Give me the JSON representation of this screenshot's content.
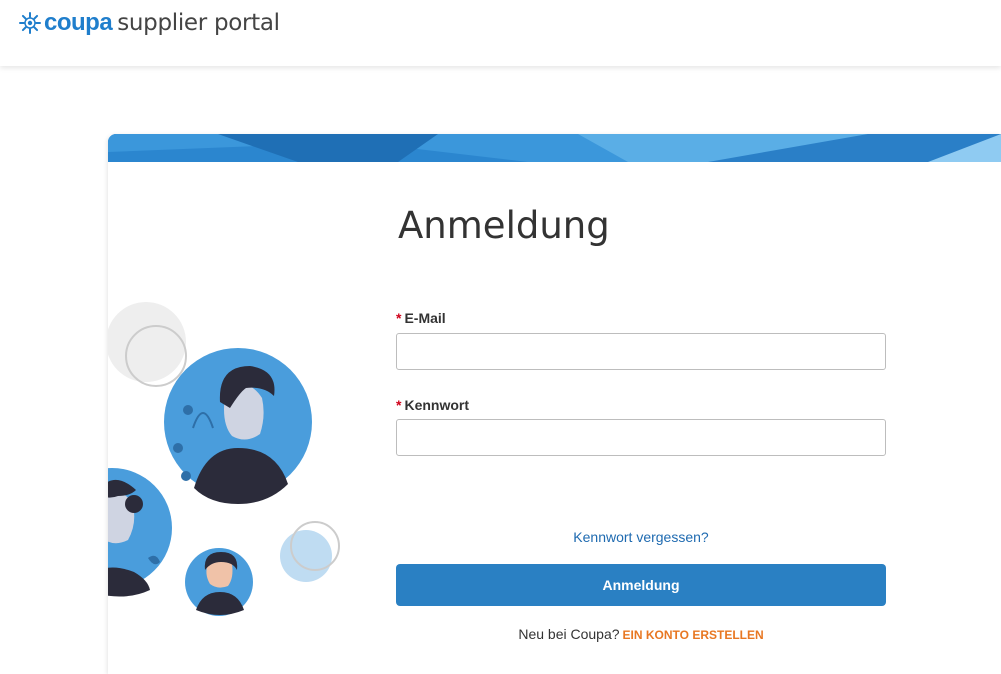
{
  "header": {
    "logo_brand": "coupa",
    "logo_rest": "supplier portal"
  },
  "login": {
    "title": "Anmeldung",
    "required_marker": "*",
    "email_label": "E-Mail",
    "email_value": "",
    "password_label": "Kennwort",
    "password_value": "",
    "forgot_link": "Kennwort vergessen?",
    "submit_label": "Anmeldung",
    "signup_prompt": "Neu bei Coupa?",
    "signup_link": "EIN KONTO ERSTELLEN"
  },
  "colors": {
    "brand_blue": "#1f7ecc",
    "button_blue": "#2a80c3",
    "link_blue": "#1e6ab0",
    "signup_orange": "#e87722",
    "required_red": "#d0021b"
  },
  "icons": {
    "logo": "coupa-starburst-icon",
    "illustration": "people-avatars-illustration"
  }
}
